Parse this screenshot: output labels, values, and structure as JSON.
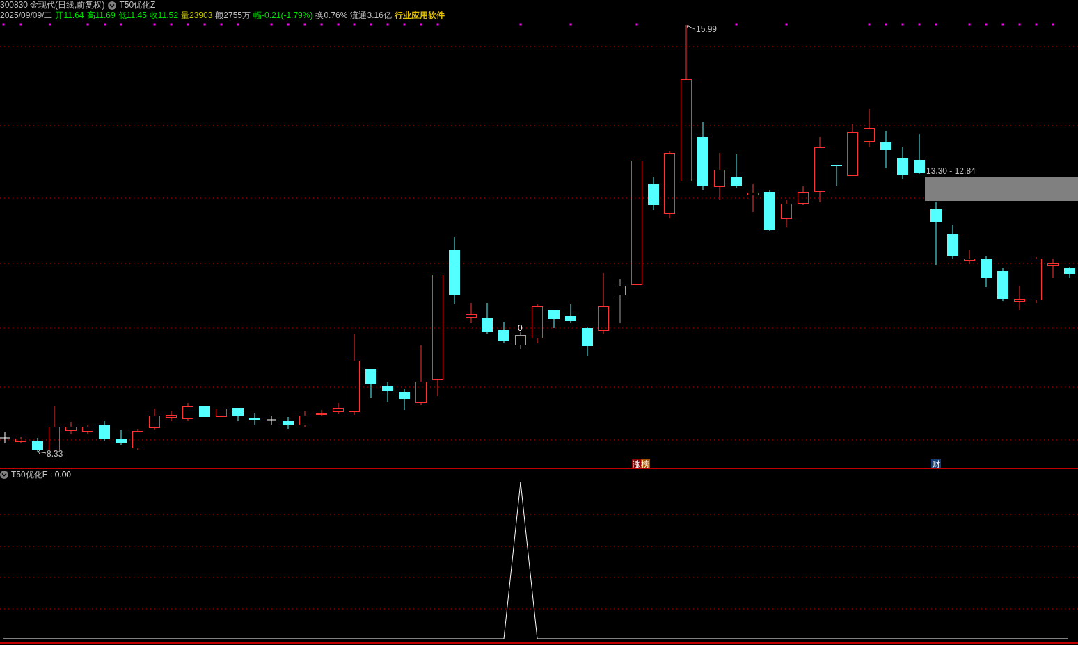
{
  "header": {
    "code": "300830",
    "name": "金现代",
    "period": "(日线,前复权)",
    "indicator": "T50优化Z"
  },
  "quote": [
    {
      "text": "2025/09/09/二",
      "color": "#c0c0c0"
    },
    {
      "text": "开11.64",
      "color": "#00e000"
    },
    {
      "text": "高11.69",
      "color": "#00e000"
    },
    {
      "text": "低11.45",
      "color": "#00e000"
    },
    {
      "text": "收11.52",
      "color": "#00e000"
    },
    {
      "text": "量23903",
      "color": "#c8c800"
    },
    {
      "text": "额2755万",
      "color": "#c0c0c0"
    },
    {
      "text": "幅-0.21(-1.79%)",
      "color": "#00e000"
    },
    {
      "text": "换0.76%",
      "color": "#c0c0c0"
    },
    {
      "text": "流通3.16亿",
      "color": "#c0c0c0"
    },
    {
      "text": "行业应用软件",
      "color": "#e0c000"
    }
  ],
  "main_chart": {
    "high_label": "15.99",
    "low_label": "8.33",
    "signal_label": "0",
    "range_label": "13.30 - 12.84",
    "tags": [
      {
        "text": "涨榜",
        "kind": "limit"
      },
      {
        "text": "财",
        "kind": "finance"
      }
    ]
  },
  "sub_chart": {
    "title": "T50优化F",
    "value": ": 0.00"
  }
}
